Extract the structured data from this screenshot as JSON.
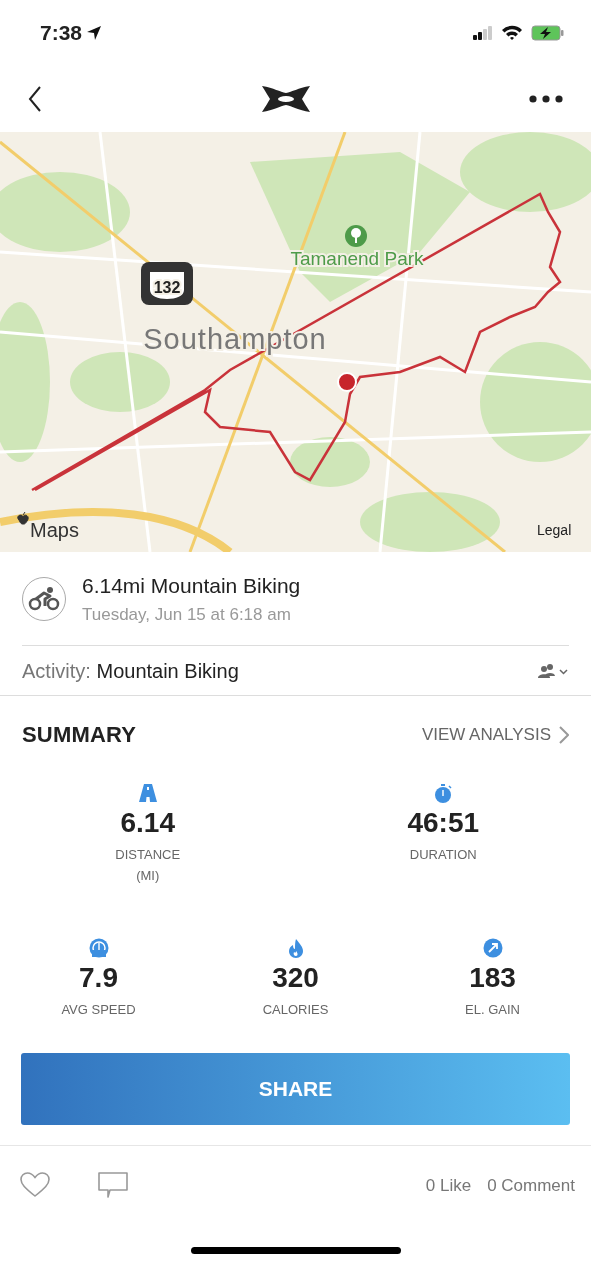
{
  "status_bar": {
    "time": "7:38"
  },
  "map": {
    "labels": [
      {
        "kind": "park",
        "text": "Tamanend Park"
      },
      {
        "kind": "shield",
        "text": "132"
      },
      {
        "kind": "town",
        "text": "Southampton"
      },
      {
        "kind": "brand",
        "text": "Maps"
      },
      {
        "kind": "legal",
        "text": "Legal"
      }
    ]
  },
  "activity": {
    "title": "6.14mi Mountain Biking",
    "date": "Tuesday, Jun 15 at 6:18 am",
    "type_label": "Activity:",
    "type_value": "Mountain Biking"
  },
  "summary": {
    "title": "SUMMARY",
    "link": "VIEW ANALYSIS"
  },
  "stats_rows": [
    [
      {
        "kind": "distance",
        "value": "6.14",
        "label": "DISTANCE",
        "unit": "(MI)"
      },
      {
        "kind": "duration",
        "value": "46:51",
        "label": "DURATION"
      }
    ],
    [
      {
        "kind": "speed",
        "value": "7.9",
        "label": "AVG SPEED"
      },
      {
        "kind": "calories",
        "value": "320",
        "label": "CALORIES"
      },
      {
        "kind": "elevation",
        "value": "183",
        "label": "EL. GAIN"
      }
    ]
  ],
  "share_button": "SHARE",
  "social": {
    "likes": "0 Like",
    "comments": "0 Comment"
  }
}
